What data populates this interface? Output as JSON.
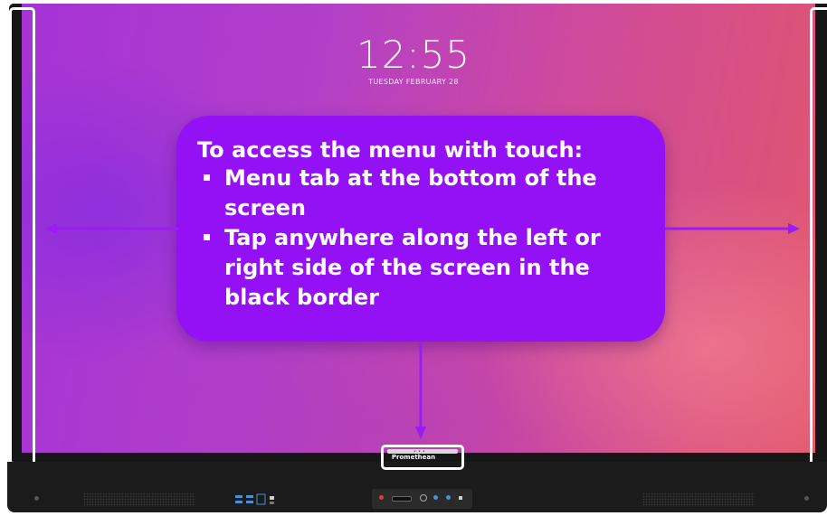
{
  "lock_screen": {
    "time": "12:55",
    "date": "TUESDAY FEBRUARY 28"
  },
  "callout": {
    "title": "To access the menu with touch:",
    "bullets": [
      "Menu tab at the bottom of the screen",
      "Tap anywhere along the left or right side of the screen in the black border"
    ]
  },
  "panel": {
    "brand": "Promethean"
  },
  "colors": {
    "callout_fill": "#9410f5",
    "arrow": "#9b1cf2",
    "highlight": "#ffffff",
    "bezel": "#161616"
  }
}
